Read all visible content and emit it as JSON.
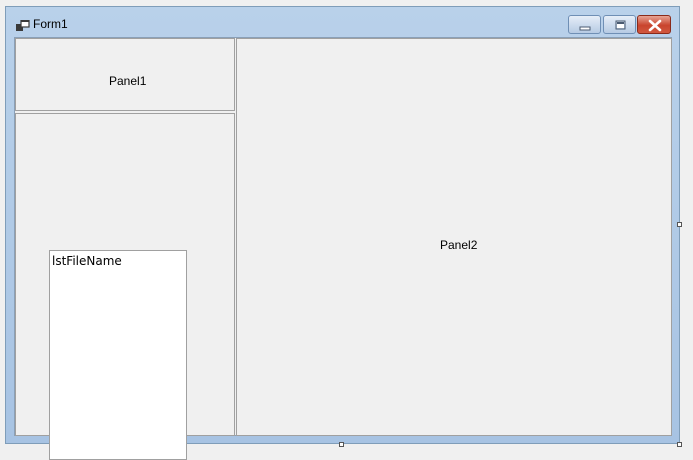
{
  "window": {
    "title": "Form1",
    "icon": "form-window-icon",
    "caption_buttons": [
      "minimize-icon",
      "maximize-icon",
      "close-icon"
    ]
  },
  "panel1": {
    "label": "Panel1"
  },
  "panel2": {
    "label": "Panel2"
  },
  "listbox": {
    "item": "lstFileName"
  },
  "colors": {
    "frame": "#a7c3e3",
    "client": "#f0f0f0",
    "close_button": "#c9442e"
  }
}
